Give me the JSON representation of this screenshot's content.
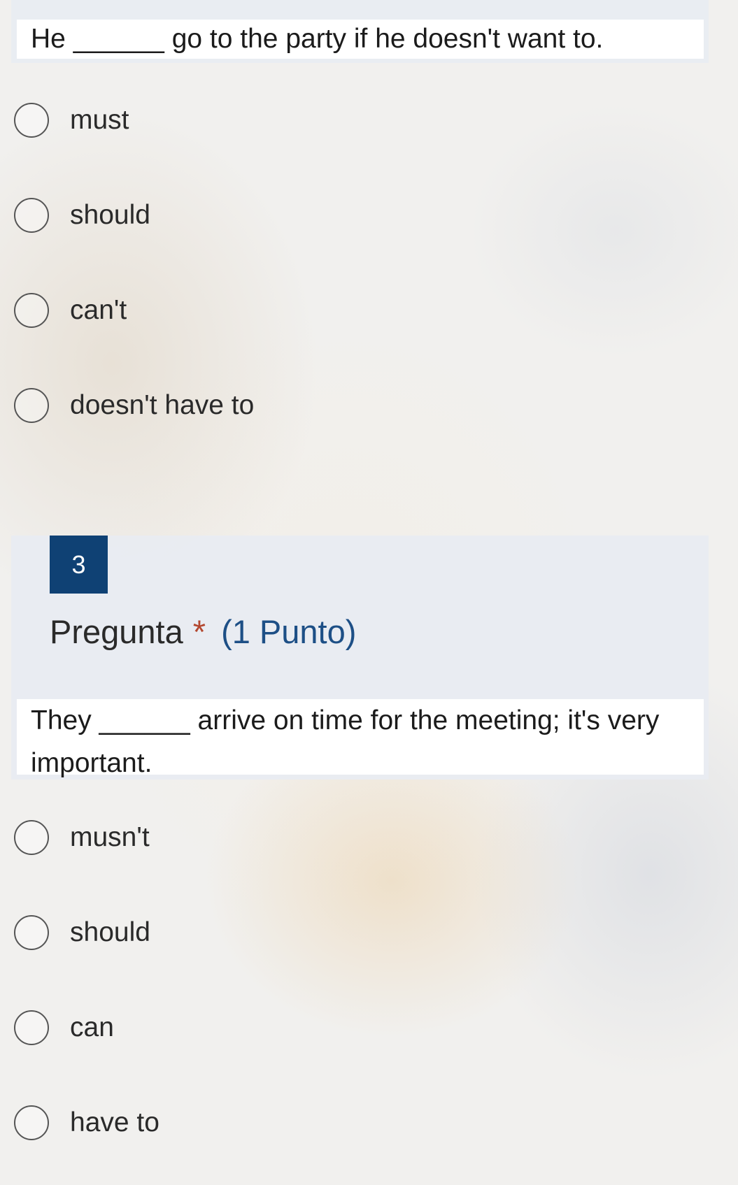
{
  "question_2": {
    "sentence_start": "He",
    "blank": "______",
    "sentence_end": "go to the party if he doesn't want to.",
    "options": [
      "must",
      "should",
      "can't",
      "doesn't have to"
    ]
  },
  "question_3": {
    "number": "3",
    "title": "Pregunta",
    "required_marker": "*",
    "points": "(1 Punto)",
    "sentence_start": "They",
    "blank": "______",
    "sentence_end": "arrive on time for the meeting; it's very important.",
    "options": [
      "musn't",
      "should",
      "can",
      "have to"
    ]
  },
  "colors": {
    "question_number_bg": "#0f4174",
    "points_text": "#1d4f86",
    "required_marker": "#b3472f",
    "card_bg": "#e8ecf2"
  },
  "icons": {
    "option_icon": "radio-circle-icon"
  }
}
